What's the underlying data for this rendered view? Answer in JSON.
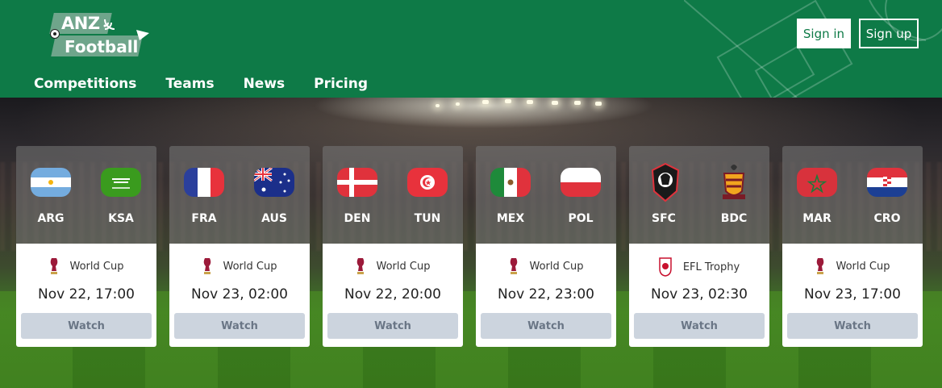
{
  "header": {
    "logo": {
      "line1": "ANZ",
      "line2": "Football"
    },
    "nav": [
      "Competitions",
      "Teams",
      "News",
      "Pricing"
    ],
    "sign_in": "Sign in",
    "sign_up": "Sign up"
  },
  "colors": {
    "brand_green": "#0e7a47",
    "watch_button_bg": "#ccd4de",
    "watch_button_text": "#6a7686"
  },
  "matches": [
    {
      "home": "ARG",
      "away": "KSA",
      "home_icon": "argentina-flag-icon",
      "away_icon": "saudi-arabia-flag-icon",
      "competition": "World Cup",
      "competition_icon": "world-cup-trophy-icon",
      "date": "Nov 22, 17:00",
      "button": "Watch"
    },
    {
      "home": "FRA",
      "away": "AUS",
      "home_icon": "france-flag-icon",
      "away_icon": "australia-flag-icon",
      "competition": "World Cup",
      "competition_icon": "world-cup-trophy-icon",
      "date": "Nov 23, 02:00",
      "button": "Watch"
    },
    {
      "home": "DEN",
      "away": "TUN",
      "home_icon": "denmark-flag-icon",
      "away_icon": "tunisia-flag-icon",
      "competition": "World Cup",
      "competition_icon": "world-cup-trophy-icon",
      "date": "Nov 22, 20:00",
      "button": "Watch"
    },
    {
      "home": "MEX",
      "away": "POL",
      "home_icon": "mexico-flag-icon",
      "away_icon": "poland-flag-icon",
      "competition": "World Cup",
      "competition_icon": "world-cup-trophy-icon",
      "date": "Nov 22, 23:00",
      "button": "Watch"
    },
    {
      "home": "SFC",
      "away": "BDC",
      "home_icon": "salford-city-crest-icon",
      "away_icon": "bradford-city-crest-icon",
      "competition": "EFL Trophy",
      "competition_icon": "efl-trophy-icon",
      "date": "Nov 23, 02:30",
      "button": "Watch"
    },
    {
      "home": "MAR",
      "away": "CRO",
      "home_icon": "morocco-flag-icon",
      "away_icon": "croatia-flag-icon",
      "competition": "World Cup",
      "competition_icon": "world-cup-trophy-icon",
      "date": "Nov 23, 17:00",
      "button": "Watch"
    }
  ]
}
